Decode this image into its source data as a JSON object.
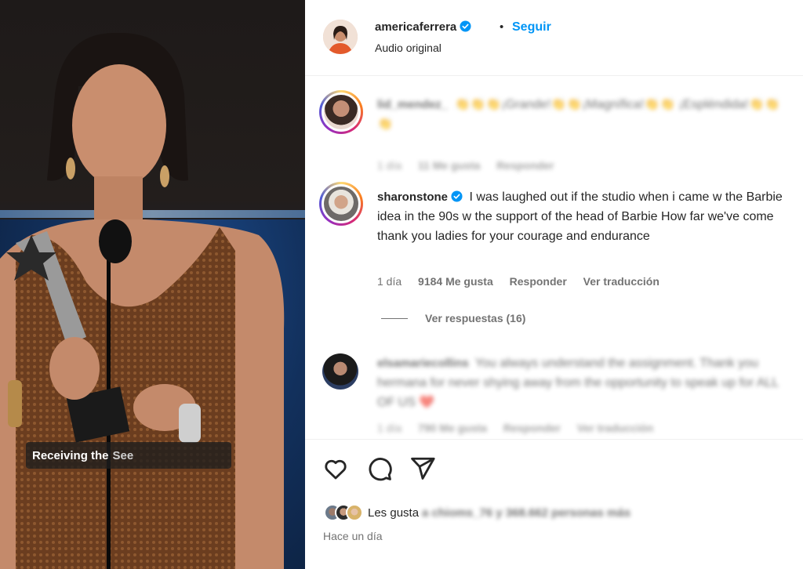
{
  "media": {
    "caption_bold": "Receiving the",
    "caption_faded": "See"
  },
  "header": {
    "username": "americaferrera",
    "separator": "•",
    "follow_label": "Seguir",
    "audio_label": "Audio original"
  },
  "comments": [
    {
      "username": "lid_mendez_",
      "text": "👏👏👏¡Grande!👏👏¡Magnífica!👏👏 ¡Espléndida!👏👏👏",
      "time": "1 día",
      "likes": "11 Me gusta",
      "reply": "Responder",
      "blurred": true
    },
    {
      "username": "sharonstone",
      "text": "I was laughed out if the studio when i came w the Barbie idea in the 90s w the support of the head of Barbie How far we've come thank you ladies for your courage and endurance",
      "time": "1 día",
      "likes": "9184 Me gusta",
      "reply": "Responder",
      "translate": "Ver traducción",
      "view_replies": "Ver respuestas (16)"
    },
    {
      "username": "elsamariecollins",
      "text": "You always understand the assignment. Thank you hermana for never shying away from the opportunity to speak up for ALL OF US ❤️",
      "time": "1 día",
      "likes": "790 Me gusta",
      "reply": "Responder",
      "translate": "Ver traducción",
      "blurred": true
    }
  ],
  "footer": {
    "likes_prefix": "Les gusta",
    "likes_rest": "a chioms_76 y 368.662 personas más",
    "time_ago": "Hace un día"
  },
  "icons": {
    "like": "heart-icon",
    "comment": "comment-bubble-icon",
    "share": "paper-plane-icon",
    "verified": "verified-badge-icon"
  },
  "colors": {
    "link_blue": "#0095f6",
    "verified_blue": "#0095f6",
    "muted_text": "#737373"
  }
}
